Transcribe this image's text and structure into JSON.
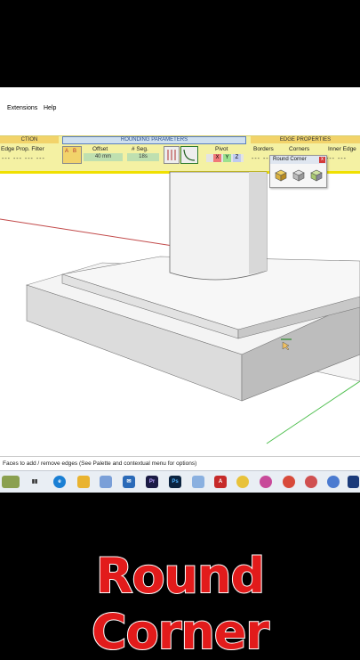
{
  "menu": {
    "extensions": "Extensions",
    "help": "Help"
  },
  "toolbar": {
    "section_left": "CTION",
    "section_mid": "ROUNDING PARAMETERS",
    "section_right": "EDGE PROPERTIES",
    "edge_prop_filter": "Edge Prop. Filter",
    "offset_label": "Offset",
    "offset_value": "40 mm",
    "seg_label": "# Seg.",
    "seg_value": "18s",
    "pivot_label": "Pivot",
    "pivot_axes": [
      "X",
      "Y",
      "Z"
    ],
    "borders": "Borders",
    "corners": "Corners",
    "inner_edge": "Inner Edge",
    "ab_buttons": [
      "A",
      "B"
    ]
  },
  "palette": {
    "title": "Round Corner",
    "close": "x",
    "icons": [
      "round-corner-tool-1",
      "round-corner-tool-2",
      "round-corner-tool-3"
    ]
  },
  "status": {
    "text": "Faces to add / remove edges (See Palette and contextual menu for options)"
  },
  "taskbar": {
    "icons": [
      "widgets",
      "task-view",
      "edge-browser",
      "file-explorer",
      "store",
      "mail",
      "premiere-pro",
      "photoshop",
      "notepad",
      "acrobat",
      "chrome",
      "chrome-profile-1",
      "chrome-profile-2",
      "chrome-profile-3",
      "chrome-profile-4",
      "sketchup"
    ]
  },
  "caption": {
    "text": "Round Corner"
  },
  "colors": {
    "caption": "#e21b1b",
    "toolbar": "#f4f1a3",
    "section": "#f2d36a"
  }
}
